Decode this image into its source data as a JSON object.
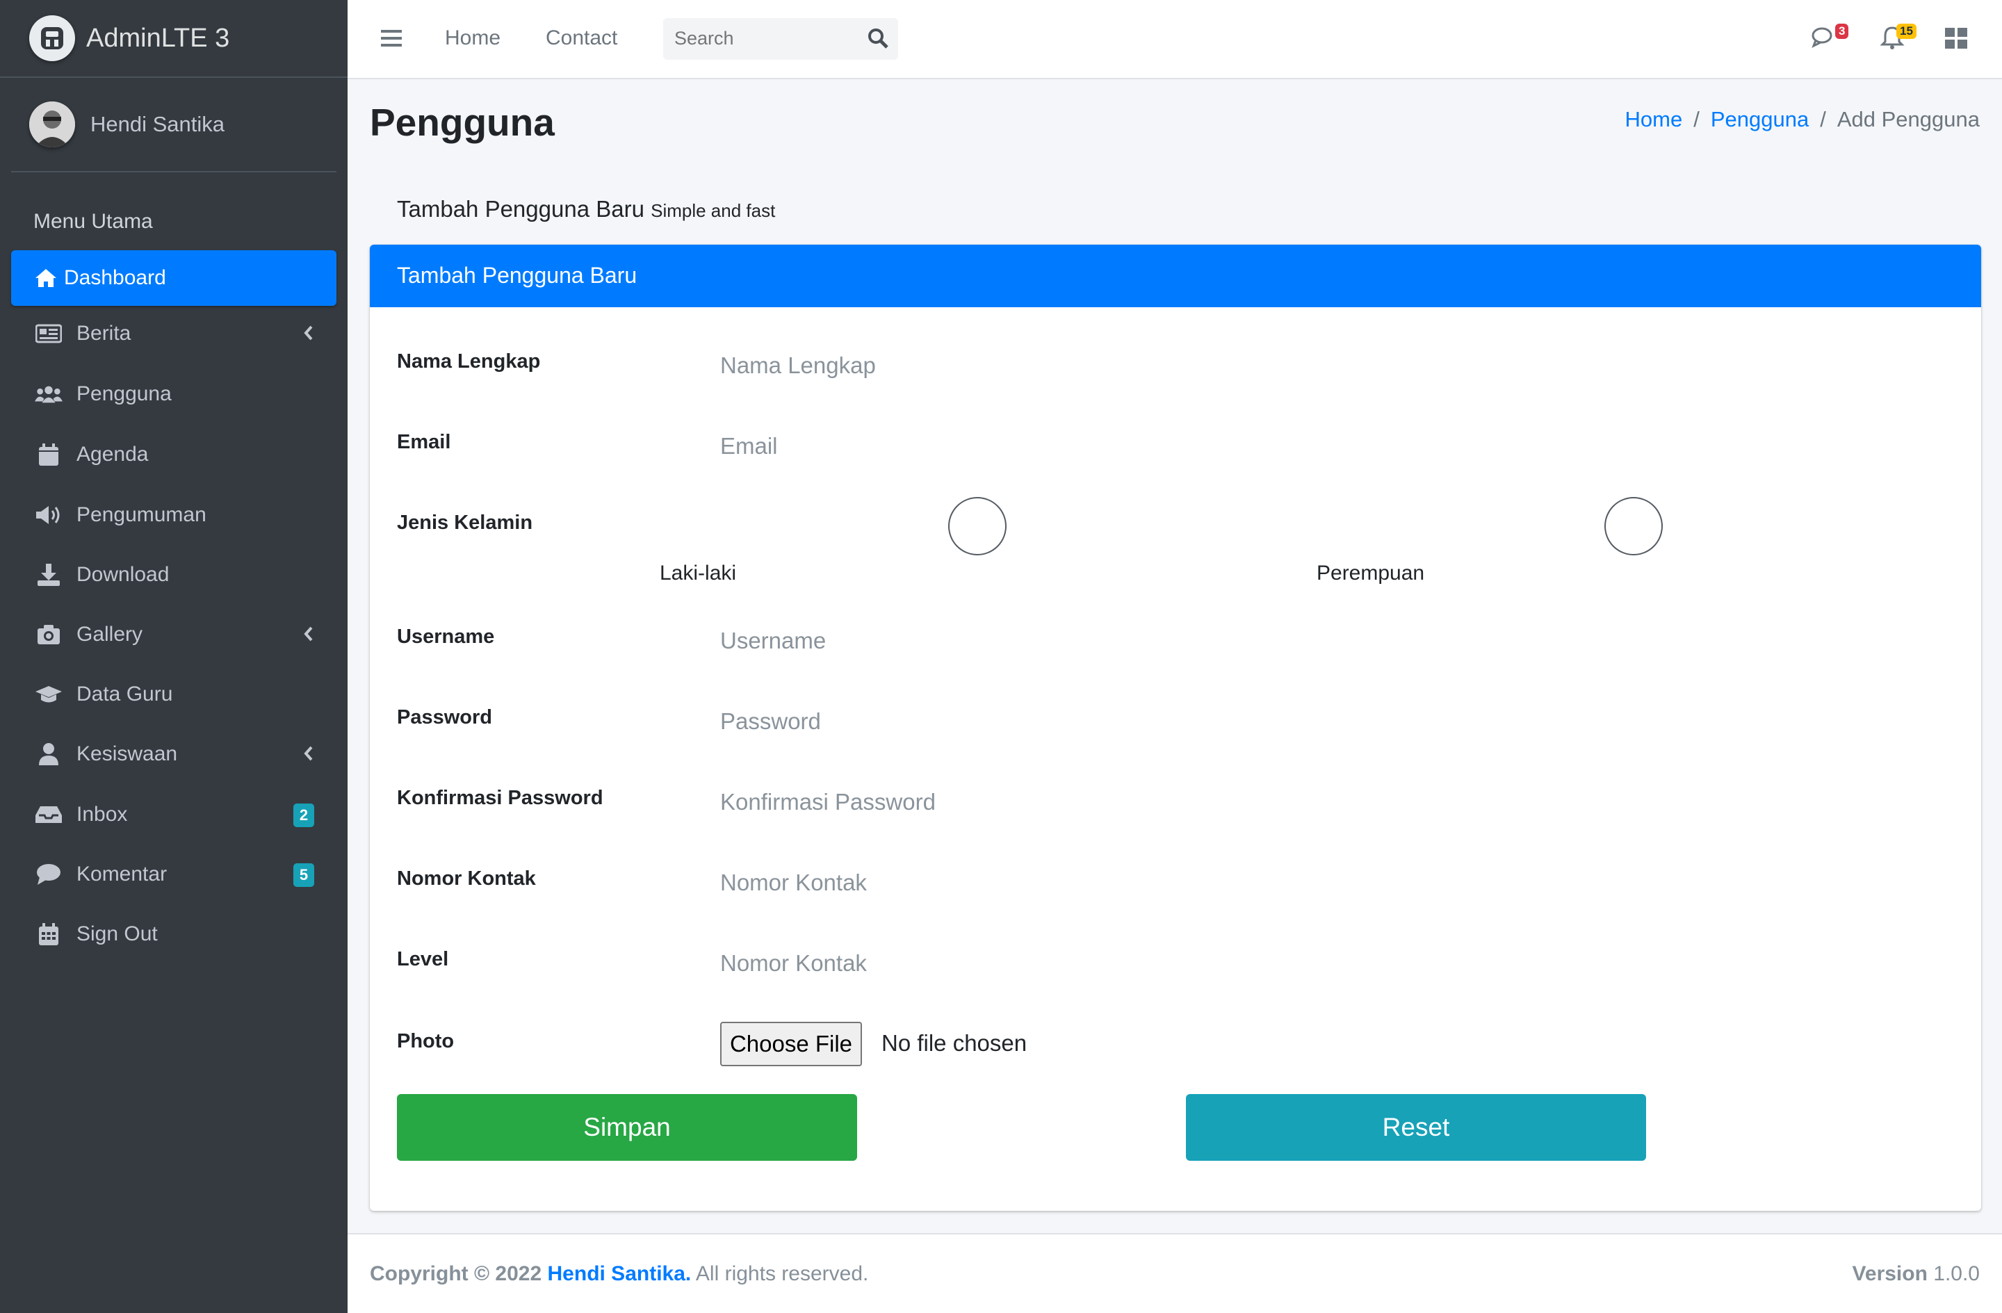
{
  "brand": {
    "name": "AdminLTE 3"
  },
  "user": {
    "name": "Hendi Santika"
  },
  "sidebar": {
    "header": "Menu Utama",
    "items": [
      {
        "label": "Dashboard",
        "icon": "home-icon",
        "active": true
      },
      {
        "label": "Berita",
        "icon": "newspaper-icon",
        "has_arrow": true
      },
      {
        "label": "Pengguna",
        "icon": "users-icon"
      },
      {
        "label": "Agenda",
        "icon": "calendar-icon"
      },
      {
        "label": "Pengumuman",
        "icon": "bullhorn-icon"
      },
      {
        "label": "Download",
        "icon": "download-icon"
      },
      {
        "label": "Gallery",
        "icon": "camera-icon",
        "has_arrow": true
      },
      {
        "label": "Data Guru",
        "icon": "graduation-cap-icon"
      },
      {
        "label": "Kesiswaan",
        "icon": "user-icon",
        "has_arrow": true
      },
      {
        "label": "Inbox",
        "icon": "inbox-icon",
        "badge": "2"
      },
      {
        "label": "Komentar",
        "icon": "comment-icon",
        "badge": "5"
      },
      {
        "label": "Sign Out",
        "icon": "calendar-grid-icon"
      }
    ]
  },
  "navbar": {
    "links": [
      "Home",
      "Contact"
    ],
    "search_placeholder": "Search",
    "messages_count": "3",
    "notifications_count": "15"
  },
  "header": {
    "title": "Pengguna",
    "breadcrumb": [
      "Home",
      "Pengguna",
      "Add Pengguna"
    ]
  },
  "section": {
    "title": "Tambah Pengguna Baru",
    "subtitle": "Simple and fast"
  },
  "card": {
    "title": "Tambah Pengguna Baru"
  },
  "form": {
    "nama_label": "Nama Lengkap",
    "nama_placeholder": "Nama Lengkap",
    "email_label": "Email",
    "email_placeholder": "Email",
    "gender_label": "Jenis Kelamin",
    "gender_options": [
      "Laki-laki",
      "Perempuan"
    ],
    "username_label": "Username",
    "username_placeholder": "Username",
    "password_label": "Password",
    "password_placeholder": "Password",
    "confirm_label": "Konfirmasi Password",
    "confirm_placeholder": "Konfirmasi Password",
    "contact_label": "Nomor Kontak",
    "contact_placeholder": "Nomor Kontak",
    "level_label": "Level",
    "level_placeholder": "Nomor Kontak",
    "photo_label": "Photo",
    "file_button": "Choose File",
    "file_status": "No file chosen",
    "save_button": "Simpan",
    "reset_button": "Reset"
  },
  "footer": {
    "copyright": "Copyright © 2022",
    "author": "Hendi Santika.",
    "rights": "All rights reserved.",
    "version_label": "Version",
    "version": "1.0.0"
  },
  "colors": {
    "primary": "#007bff",
    "sidebar": "#343a40",
    "success": "#28a745",
    "info": "#17a2b8",
    "danger": "#dc3545",
    "warning": "#ffc107"
  }
}
